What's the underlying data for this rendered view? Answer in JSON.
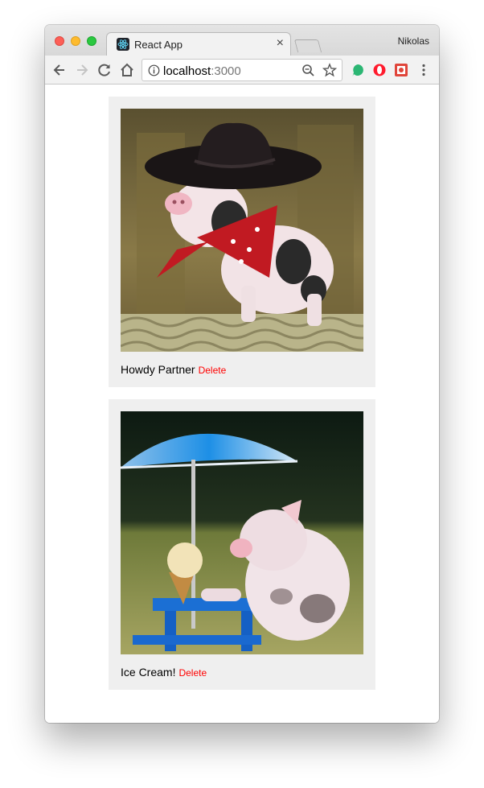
{
  "browser": {
    "tab_title": "React App",
    "tab_close": "×",
    "profile_name": "Nikolas",
    "url_host": "localhost",
    "url_port": ":3000"
  },
  "posts": [
    {
      "title": "Howdy Partner",
      "delete_label": "Delete",
      "image": "pig-in-cowboy-hat-and-red-bandana"
    },
    {
      "title": "Ice Cream!",
      "delete_label": "Delete",
      "image": "pig-with-ice-cream-under-umbrella"
    }
  ],
  "colors": {
    "delete_link": "#ff0000",
    "card_background": "#efefef"
  }
}
